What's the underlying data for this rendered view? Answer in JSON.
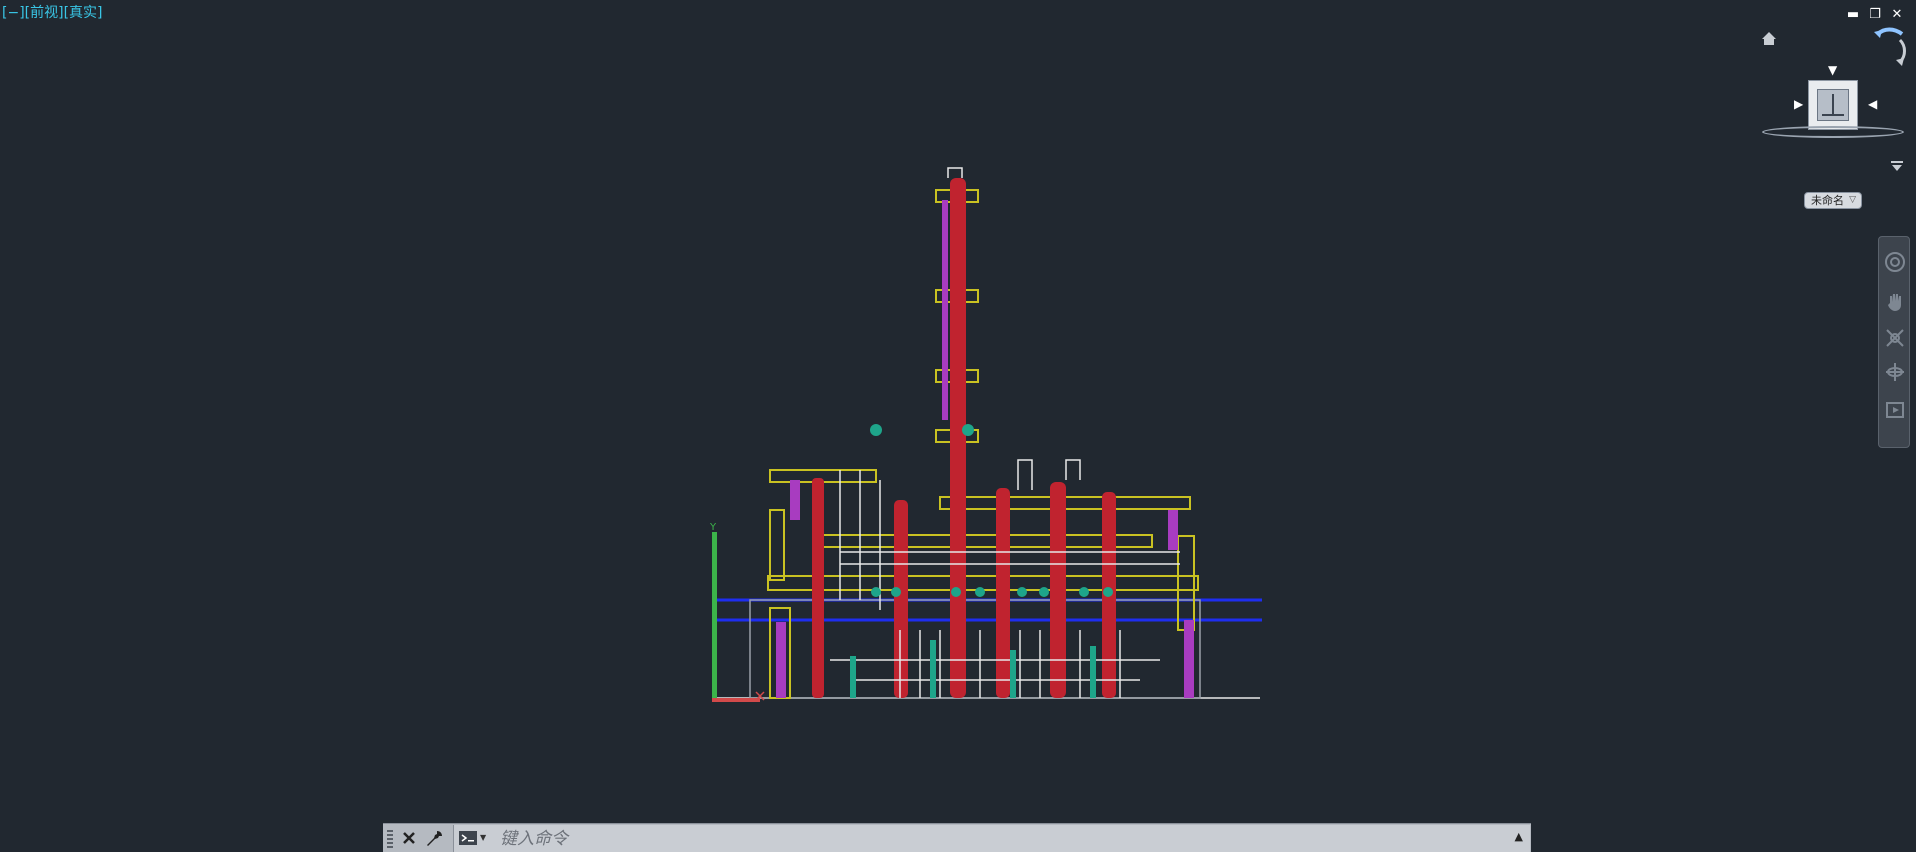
{
  "viewport": {
    "label": "[−][前视][真实]"
  },
  "window_controls": {
    "minimize": "▬",
    "restore": "❐",
    "close": "✕"
  },
  "viewcube": {
    "ucs_label": "未命名",
    "arrows": {
      "top": "▼",
      "left": "▶",
      "right": "◀"
    }
  },
  "command_line": {
    "placeholder": "键入命令",
    "value": "",
    "history_arrow": "▲"
  },
  "ucs_axes": {
    "x": "X",
    "y": "Y"
  },
  "colors": {
    "background": "#212830",
    "viewport_label": "#39c6e6",
    "column_red": "#c0232f",
    "platform_yellow": "#c9c222",
    "ladder_purple": "#a83cc0",
    "pipe_blue": "#1e2ef0",
    "equipment_teal": "#1ea58a",
    "pipe_white": "#e8e8e8"
  }
}
